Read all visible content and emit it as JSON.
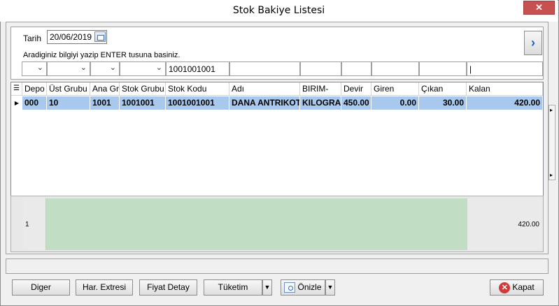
{
  "window": {
    "title": "Stok Bakiye Listesi",
    "close_glyph": "✕"
  },
  "filter": {
    "tarih_label": "Tarih",
    "tarih_value": "20/06/2019",
    "hint": "Aradiginiz bilgiyi yazip ENTER tusuna basiniz.",
    "stok_kodu_value": "1001001001",
    "nav_glyph": "›"
  },
  "grid": {
    "columns": [
      "Depo",
      "Üst Grubu",
      "Ana Gr",
      "Stok Grubu",
      "Stok Kodu",
      "Adı",
      "BIRIM-",
      "Devir",
      "Giren",
      "Çıkan",
      "Kalan"
    ],
    "rows": [
      [
        "000",
        "10",
        "1001",
        "1001001",
        "1001001001",
        "DANA ANTRIKOT",
        "KILOGRAI",
        "450.00",
        "0.00",
        "30.00",
        "420.00"
      ]
    ],
    "footer": {
      "count": "1",
      "total": "420.00"
    }
  },
  "buttons": {
    "diger": "Diger",
    "har_extresi": "Har. Extresi",
    "fiyat_detay": "Fiyat Detay",
    "tuketim": "Tüketim",
    "onizle": "Önizle",
    "kapat": "Kapat"
  },
  "colors": {
    "selected_row": "#a8c8ee",
    "footer_green": "#c1dec4",
    "close_red": "#c75050"
  }
}
